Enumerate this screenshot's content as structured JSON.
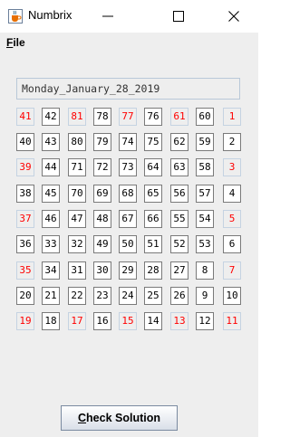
{
  "window": {
    "title": "Numbrix",
    "minimize_glyph": "—",
    "maximize_glyph": "☐",
    "close_glyph": "✕"
  },
  "menu": {
    "file_mnemonic": "F",
    "file_rest": "ile"
  },
  "date_field": {
    "value": "Monday_January_28_2019"
  },
  "grid": {
    "rows": [
      [
        {
          "v": "41",
          "given": true
        },
        {
          "v": "42",
          "given": false
        },
        {
          "v": "81",
          "given": true
        },
        {
          "v": "78",
          "given": false
        },
        {
          "v": "77",
          "given": true
        },
        {
          "v": "76",
          "given": false
        },
        {
          "v": "61",
          "given": true
        },
        {
          "v": "60",
          "given": false
        },
        {
          "v": "1",
          "given": true
        }
      ],
      [
        {
          "v": "40",
          "given": false
        },
        {
          "v": "43",
          "given": false
        },
        {
          "v": "80",
          "given": false
        },
        {
          "v": "79",
          "given": false
        },
        {
          "v": "74",
          "given": false
        },
        {
          "v": "75",
          "given": false
        },
        {
          "v": "62",
          "given": false
        },
        {
          "v": "59",
          "given": false
        },
        {
          "v": "2",
          "given": false
        }
      ],
      [
        {
          "v": "39",
          "given": true
        },
        {
          "v": "44",
          "given": false
        },
        {
          "v": "71",
          "given": false
        },
        {
          "v": "72",
          "given": false
        },
        {
          "v": "73",
          "given": false
        },
        {
          "v": "64",
          "given": false
        },
        {
          "v": "63",
          "given": false
        },
        {
          "v": "58",
          "given": false
        },
        {
          "v": "3",
          "given": true
        }
      ],
      [
        {
          "v": "38",
          "given": false
        },
        {
          "v": "45",
          "given": false
        },
        {
          "v": "70",
          "given": false
        },
        {
          "v": "69",
          "given": false
        },
        {
          "v": "68",
          "given": false
        },
        {
          "v": "65",
          "given": false
        },
        {
          "v": "56",
          "given": false
        },
        {
          "v": "57",
          "given": false
        },
        {
          "v": "4",
          "given": false
        }
      ],
      [
        {
          "v": "37",
          "given": true
        },
        {
          "v": "46",
          "given": false
        },
        {
          "v": "47",
          "given": false
        },
        {
          "v": "48",
          "given": false
        },
        {
          "v": "67",
          "given": false
        },
        {
          "v": "66",
          "given": false
        },
        {
          "v": "55",
          "given": false
        },
        {
          "v": "54",
          "given": false
        },
        {
          "v": "5",
          "given": true
        }
      ],
      [
        {
          "v": "36",
          "given": false
        },
        {
          "v": "33",
          "given": false
        },
        {
          "v": "32",
          "given": false
        },
        {
          "v": "49",
          "given": false
        },
        {
          "v": "50",
          "given": false
        },
        {
          "v": "51",
          "given": false
        },
        {
          "v": "52",
          "given": false
        },
        {
          "v": "53",
          "given": false
        },
        {
          "v": "6",
          "given": false
        }
      ],
      [
        {
          "v": "35",
          "given": true
        },
        {
          "v": "34",
          "given": false
        },
        {
          "v": "31",
          "given": false
        },
        {
          "v": "30",
          "given": false
        },
        {
          "v": "29",
          "given": false
        },
        {
          "v": "28",
          "given": false
        },
        {
          "v": "27",
          "given": false
        },
        {
          "v": "8",
          "given": false
        },
        {
          "v": "7",
          "given": true
        }
      ],
      [
        {
          "v": "20",
          "given": false
        },
        {
          "v": "21",
          "given": false
        },
        {
          "v": "22",
          "given": false
        },
        {
          "v": "23",
          "given": false
        },
        {
          "v": "24",
          "given": false
        },
        {
          "v": "25",
          "given": false
        },
        {
          "v": "26",
          "given": false
        },
        {
          "v": "9",
          "given": false
        },
        {
          "v": "10",
          "given": false
        }
      ],
      [
        {
          "v": "19",
          "given": true
        },
        {
          "v": "18",
          "given": false
        },
        {
          "v": "17",
          "given": true
        },
        {
          "v": "16",
          "given": false
        },
        {
          "v": "15",
          "given": true
        },
        {
          "v": "14",
          "given": false
        },
        {
          "v": "13",
          "given": true
        },
        {
          "v": "12",
          "given": false
        },
        {
          "v": "11",
          "given": true
        }
      ]
    ]
  },
  "buttons": {
    "check_mnemonic": "C",
    "check_rest": "heck Solution"
  },
  "colors": {
    "given_number": "#ff0000",
    "entered_number": "#000000",
    "panel_background": "#eeeeee"
  },
  "icons": {
    "app": "java-cup-icon",
    "minimize": "minimize-icon",
    "maximize": "maximize-icon",
    "close": "close-icon"
  }
}
